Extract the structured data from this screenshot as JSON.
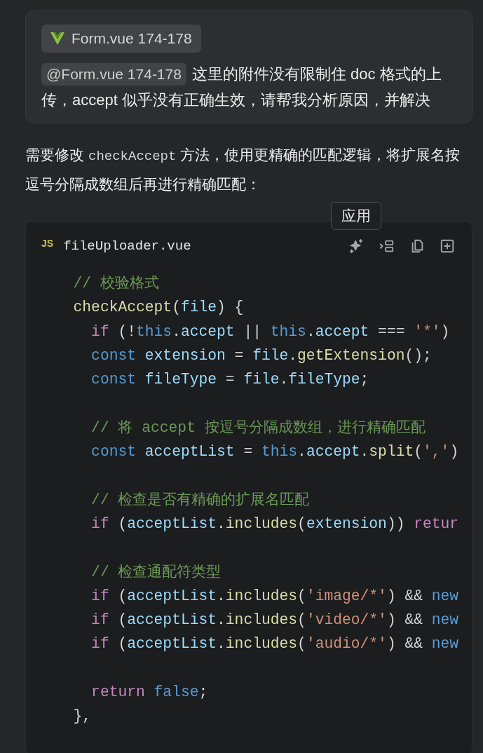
{
  "user_message": {
    "attachment": {
      "label": "Form.vue 174-178"
    },
    "mention": "@Form.vue 174-178",
    "text": "这里的附件没有限制住 doc 格式的上传，accept 似乎没有正确生效，请帮我分析原因，并解决"
  },
  "answer": {
    "parts": [
      {
        "kind": "text",
        "text": "需要修改"
      },
      {
        "kind": "code",
        "text": "checkAccept"
      },
      {
        "kind": "text",
        "text": "方法，使用更精确的匹配逻辑，将扩展名按逗号分隔成数组后再进行精确匹配："
      }
    ]
  },
  "code_block": {
    "lang_badge": "JS",
    "filename": "fileUploader.vue",
    "tooltip": "应用",
    "lines": [
      {
        "kind": "code",
        "tokens": [
          {
            "kind": "comment",
            "text": "  // 校验格式"
          }
        ]
      },
      {
        "kind": "code",
        "tokens": [
          {
            "kind": "func",
            "text": "  checkAccept"
          },
          {
            "kind": "plain",
            "text": "("
          },
          {
            "kind": "var",
            "text": "file"
          },
          {
            "kind": "plain",
            "text": ") {"
          }
        ]
      },
      {
        "kind": "code",
        "tokens": [
          {
            "kind": "keyword",
            "text": "    if"
          },
          {
            "kind": "plain",
            "text": " (!"
          },
          {
            "kind": "storage",
            "text": "this"
          },
          {
            "kind": "plain",
            "text": "."
          },
          {
            "kind": "var",
            "text": "accept"
          },
          {
            "kind": "plain",
            "text": " || "
          },
          {
            "kind": "storage",
            "text": "this"
          },
          {
            "kind": "plain",
            "text": "."
          },
          {
            "kind": "var",
            "text": "accept"
          },
          {
            "kind": "plain",
            "text": " === "
          },
          {
            "kind": "string",
            "text": "'*'"
          },
          {
            "kind": "plain",
            "text": ")"
          }
        ]
      },
      {
        "kind": "code",
        "tokens": [
          {
            "kind": "storage",
            "text": "    const"
          },
          {
            "kind": "var",
            "text": " extension"
          },
          {
            "kind": "plain",
            "text": " = "
          },
          {
            "kind": "var",
            "text": "file"
          },
          {
            "kind": "plain",
            "text": "."
          },
          {
            "kind": "func",
            "text": "getExtension"
          },
          {
            "kind": "plain",
            "text": "();"
          }
        ]
      },
      {
        "kind": "code",
        "tokens": [
          {
            "kind": "storage",
            "text": "    const"
          },
          {
            "kind": "var",
            "text": " fileType"
          },
          {
            "kind": "plain",
            "text": " = "
          },
          {
            "kind": "var",
            "text": "file"
          },
          {
            "kind": "plain",
            "text": "."
          },
          {
            "kind": "var",
            "text": "fileType"
          },
          {
            "kind": "plain",
            "text": ";"
          }
        ]
      },
      {
        "kind": "blank"
      },
      {
        "kind": "code",
        "tokens": [
          {
            "kind": "comment",
            "text": "    // 将 accept 按逗号分隔成数组，进行精确匹配"
          }
        ]
      },
      {
        "kind": "code",
        "tokens": [
          {
            "kind": "storage",
            "text": "    const"
          },
          {
            "kind": "var",
            "text": " acceptList"
          },
          {
            "kind": "plain",
            "text": " = "
          },
          {
            "kind": "storage",
            "text": "this"
          },
          {
            "kind": "plain",
            "text": "."
          },
          {
            "kind": "var",
            "text": "accept"
          },
          {
            "kind": "plain",
            "text": "."
          },
          {
            "kind": "func",
            "text": "split"
          },
          {
            "kind": "plain",
            "text": "("
          },
          {
            "kind": "string",
            "text": "','"
          },
          {
            "kind": "plain",
            "text": ")"
          }
        ]
      },
      {
        "kind": "blank"
      },
      {
        "kind": "code",
        "tokens": [
          {
            "kind": "comment",
            "text": "    // 检查是否有精确的扩展名匹配"
          }
        ]
      },
      {
        "kind": "code",
        "tokens": [
          {
            "kind": "keyword",
            "text": "    if"
          },
          {
            "kind": "plain",
            "text": " ("
          },
          {
            "kind": "var",
            "text": "acceptList"
          },
          {
            "kind": "plain",
            "text": "."
          },
          {
            "kind": "func",
            "text": "includes"
          },
          {
            "kind": "plain",
            "text": "("
          },
          {
            "kind": "var",
            "text": "extension"
          },
          {
            "kind": "plain",
            "text": ")) "
          },
          {
            "kind": "keyword",
            "text": "retur"
          }
        ]
      },
      {
        "kind": "blank"
      },
      {
        "kind": "code",
        "tokens": [
          {
            "kind": "comment",
            "text": "    // 检查通配符类型"
          }
        ]
      },
      {
        "kind": "code",
        "tokens": [
          {
            "kind": "keyword",
            "text": "    if"
          },
          {
            "kind": "plain",
            "text": " ("
          },
          {
            "kind": "var",
            "text": "acceptList"
          },
          {
            "kind": "plain",
            "text": "."
          },
          {
            "kind": "func",
            "text": "includes"
          },
          {
            "kind": "plain",
            "text": "("
          },
          {
            "kind": "string",
            "text": "'image/*'"
          },
          {
            "kind": "plain",
            "text": ") && "
          },
          {
            "kind": "storage",
            "text": "new"
          }
        ]
      },
      {
        "kind": "code",
        "tokens": [
          {
            "kind": "keyword",
            "text": "    if"
          },
          {
            "kind": "plain",
            "text": " ("
          },
          {
            "kind": "var",
            "text": "acceptList"
          },
          {
            "kind": "plain",
            "text": "."
          },
          {
            "kind": "func",
            "text": "includes"
          },
          {
            "kind": "plain",
            "text": "("
          },
          {
            "kind": "string",
            "text": "'video/*'"
          },
          {
            "kind": "plain",
            "text": ") && "
          },
          {
            "kind": "storage",
            "text": "new"
          }
        ]
      },
      {
        "kind": "code",
        "tokens": [
          {
            "kind": "keyword",
            "text": "    if"
          },
          {
            "kind": "plain",
            "text": " ("
          },
          {
            "kind": "var",
            "text": "acceptList"
          },
          {
            "kind": "plain",
            "text": "."
          },
          {
            "kind": "func",
            "text": "includes"
          },
          {
            "kind": "plain",
            "text": "("
          },
          {
            "kind": "string",
            "text": "'audio/*'"
          },
          {
            "kind": "plain",
            "text": ") && "
          },
          {
            "kind": "storage",
            "text": "new"
          }
        ]
      },
      {
        "kind": "blank"
      },
      {
        "kind": "code",
        "tokens": [
          {
            "kind": "keyword",
            "text": "    return"
          },
          {
            "kind": "storage",
            "text": " false"
          },
          {
            "kind": "plain",
            "text": ";"
          }
        ]
      },
      {
        "kind": "code",
        "tokens": [
          {
            "kind": "plain",
            "text": "  },"
          }
        ]
      }
    ]
  }
}
